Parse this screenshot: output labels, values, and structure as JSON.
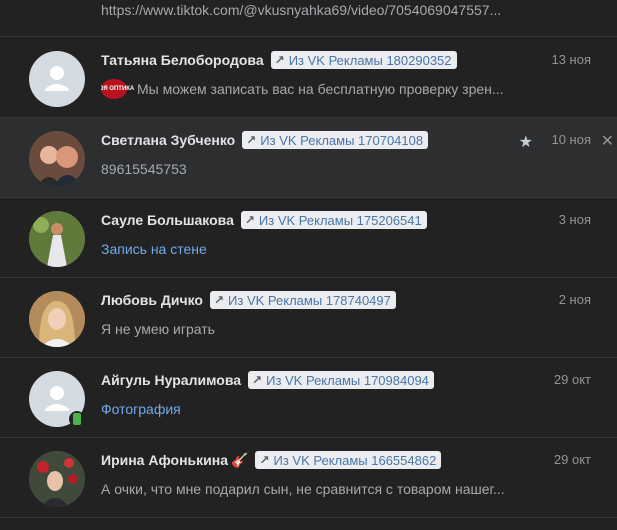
{
  "colors": {
    "background": "#222222",
    "row_highlight": "#2d2e2f",
    "link": "#71aaeb",
    "tag_bg": "#ebedf0",
    "tag_text": "#4a76a8",
    "muted": "#939393",
    "online_mobile": "#4bb34b"
  },
  "tag_icon": "arrow-up-right-icon",
  "top_item": {
    "preview": "https://www.tiktok.com/@vkusnyahka69/video/7054069047557..."
  },
  "dialogs": [
    {
      "name": "Татьяна Белобородова",
      "tag": "Из VK Рекламы 180290352",
      "date": "13 ноя",
      "preview": "Мы можем записать вас на бесплатную проверку зрен...",
      "preview_sender_badge": "МОЯ ОПТИКА",
      "avatar": "placeholder-avatar"
    },
    {
      "name": "Светлана Зубченко",
      "tag": "Из VK Рекламы 170704108",
      "date": "10 ноя",
      "preview": "89615545753",
      "starred": true,
      "highlighted": true,
      "avatar": "photo-avatar"
    },
    {
      "name": "Сауле Большакова",
      "tag": "Из VK Рекламы 175206541",
      "date": "3 ноя",
      "preview": "Запись на стене",
      "preview_is_link": true,
      "avatar": "photo-avatar"
    },
    {
      "name": "Любовь Дичко",
      "tag": "Из VK Рекламы 178740497",
      "date": "2 ноя",
      "preview": "Я не умею играть",
      "avatar": "photo-avatar"
    },
    {
      "name": "Айгуль Нуралимова",
      "tag": "Из VK Рекламы 170984094",
      "date": "29 окт",
      "preview": "Фотография",
      "preview_is_link": true,
      "online_mobile": true,
      "avatar": "placeholder-avatar"
    },
    {
      "name": "Ирина Афонькина",
      "name_emoji": "🎸",
      "tag": "Из VK Рекламы 166554862",
      "date": "29 окт",
      "preview": "А очки, что мне подарил сын, не сравнится с товаром нашег...",
      "avatar": "photo-avatar"
    }
  ]
}
